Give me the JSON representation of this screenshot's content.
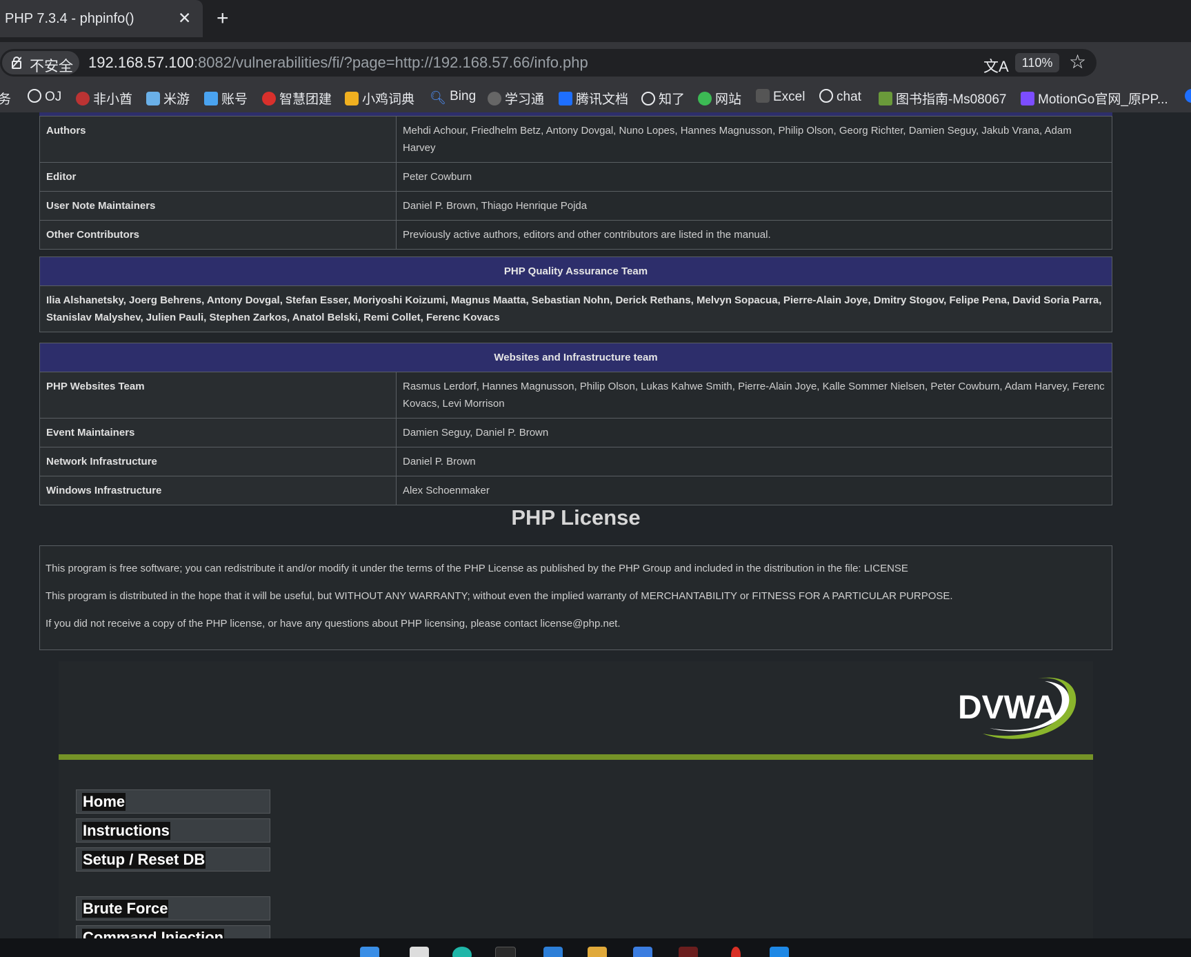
{
  "tab": {
    "title": "PHP 7.3.4 - phpinfo()",
    "close": "✕",
    "new_tab": "+"
  },
  "address": {
    "security_label": "不安全",
    "url_host": "192.168.57.100",
    "url_rest": ":8082/vulnerabilities/fi/?page=http://192.168.57.66/info.php",
    "zoom": "110%"
  },
  "bookmarks": [
    {
      "label": "服务",
      "icon": "generic-icon"
    },
    {
      "label": "OJ",
      "icon": "globe-icon"
    },
    {
      "label": "非小酋",
      "icon": "site-icon"
    },
    {
      "label": "米游",
      "icon": "site-icon"
    },
    {
      "label": "账号",
      "icon": "site-icon"
    },
    {
      "label": "智慧团建",
      "icon": "site-icon"
    },
    {
      "label": "小鸡词典",
      "icon": "site-icon"
    },
    {
      "label": "Bing",
      "icon": "search-icon"
    },
    {
      "label": "学习通",
      "icon": "site-icon"
    },
    {
      "label": "腾讯文档",
      "icon": "site-icon"
    },
    {
      "label": "知了",
      "icon": "globe-icon"
    },
    {
      "label": "网站",
      "icon": "site-icon"
    },
    {
      "label": "Excel",
      "icon": "site-icon"
    },
    {
      "label": "chat",
      "icon": "openai-icon"
    },
    {
      "label": "图书指南-Ms08067",
      "icon": "site-icon"
    },
    {
      "label": "MotionGo官网_原PP...",
      "icon": "site-icon"
    }
  ],
  "credits_table": [
    {
      "label": "Authors",
      "value": "Mehdi Achour, Friedhelm Betz, Antony Dovgal, Nuno Lopes, Hannes Magnusson, Philip Olson, Georg Richter, Damien Seguy, Jakub Vrana, Adam Harvey"
    },
    {
      "label": "Editor",
      "value": "Peter Cowburn"
    },
    {
      "label": "User Note Maintainers",
      "value": "Daniel P. Brown, Thiago Henrique Pojda"
    },
    {
      "label": "Other Contributors",
      "value": "Previously active authors, editors and other contributors are listed in the manual."
    }
  ],
  "qa_team": {
    "heading": "PHP Quality Assurance Team",
    "members": "Ilia Alshanetsky, Joerg Behrens, Antony Dovgal, Stefan Esser, Moriyoshi Koizumi, Magnus Maatta, Sebastian Nohn, Derick Rethans, Melvyn Sopacua, Pierre-Alain Joye, Dmitry Stogov, Felipe Pena, David Soria Parra, Stanislav Malyshev, Julien Pauli, Stephen Zarkos, Anatol Belski, Remi Collet, Ferenc Kovacs"
  },
  "web_team": {
    "heading": "Websites and Infrastructure team",
    "rows": [
      {
        "label": "PHP Websites Team",
        "value": "Rasmus Lerdorf, Hannes Magnusson, Philip Olson, Lukas Kahwe Smith, Pierre-Alain Joye, Kalle Sommer Nielsen, Peter Cowburn, Adam Harvey, Ferenc Kovacs, Levi Morrison"
      },
      {
        "label": "Event Maintainers",
        "value": "Damien Seguy, Daniel P. Brown"
      },
      {
        "label": "Network Infrastructure",
        "value": "Daniel P. Brown"
      },
      {
        "label": "Windows Infrastructure",
        "value": "Alex Schoenmaker"
      }
    ]
  },
  "license": {
    "heading": "PHP License",
    "p1": "This program is free software; you can redistribute it and/or modify it under the terms of the PHP License as published by the PHP Group and included in the distribution in the file: LICENSE",
    "p2": "This program is distributed in the hope that it will be useful, but WITHOUT ANY WARRANTY; without even the implied warranty of MERCHANTABILITY or FITNESS FOR A PARTICULAR PURPOSE.",
    "p3": "If you did not receive a copy of the PHP license, or have any questions about PHP licensing, please contact license@php.net."
  },
  "dvwa": {
    "logo_text": "DVWA",
    "menu": [
      "Home",
      "Instructions",
      "Setup / Reset DB",
      "Brute Force",
      "Command Injection"
    ]
  },
  "colors": {
    "header_blue": "#2d2e6b",
    "dvwa_green": "#759327"
  }
}
